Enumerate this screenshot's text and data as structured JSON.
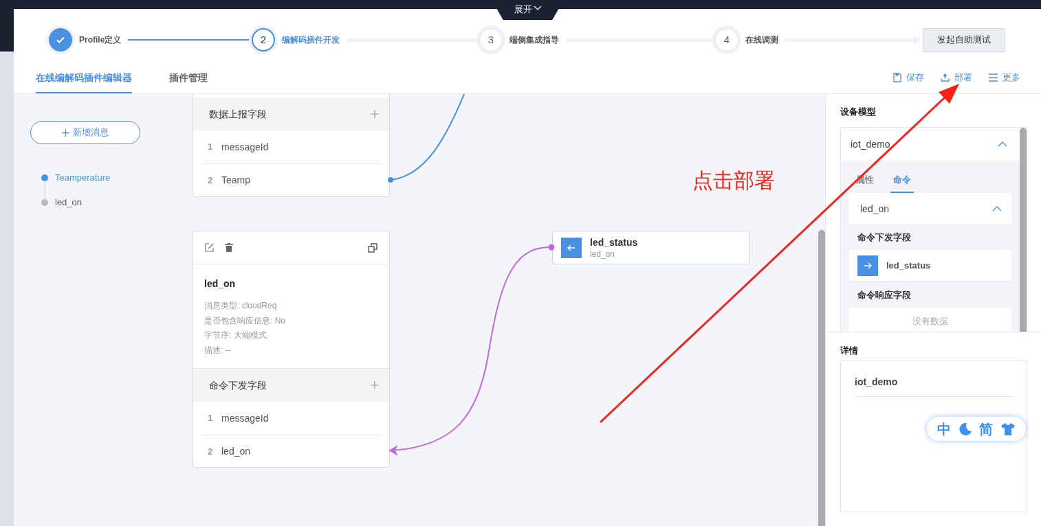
{
  "expand_tab": {
    "label": "展开"
  },
  "steps": [
    {
      "label": "Profile定义",
      "completed": true,
      "selected": false
    },
    {
      "number": "2",
      "label": "编解码插件开发",
      "completed": false,
      "selected": true
    },
    {
      "number": "3",
      "label": "端侧集成指导",
      "completed": false,
      "selected": false
    },
    {
      "number": "4",
      "label": "在线调测",
      "completed": false,
      "selected": false
    }
  ],
  "test_button": "发起自助测试",
  "tabs": [
    {
      "label": "在线编解码插件编辑器",
      "selected": true
    },
    {
      "label": "插件管理",
      "selected": false
    }
  ],
  "actions": [
    {
      "kind": "save",
      "label": "保存"
    },
    {
      "kind": "deploy",
      "label": "部署"
    },
    {
      "kind": "more",
      "label": "更多"
    }
  ],
  "sidebar": {
    "add_button": "新增消息",
    "messages": [
      {
        "label": "Teamperature",
        "selected": true
      },
      {
        "label": "led_on",
        "selected": false
      }
    ]
  },
  "canvas": {
    "report_card": {
      "section": "数据上报字段",
      "fields": [
        {
          "index": "1",
          "name": "messageId"
        },
        {
          "index": "2",
          "name": "Teamp"
        }
      ]
    },
    "command_card": {
      "title": "led_on",
      "details": [
        "消息类型: cloudReq",
        "是否包含响应信息: No",
        "字节序: 大端模式",
        "描述: --"
      ],
      "section": "命令下发字段",
      "fields": [
        {
          "index": "1",
          "name": "messageId"
        },
        {
          "index": "2",
          "name": "led_on"
        }
      ]
    },
    "node": {
      "name": "led_status",
      "subtitle": "led_on"
    }
  },
  "model_panel": {
    "title": "设备模型",
    "device": "iot_demo",
    "expanded": true,
    "tabs": [
      {
        "label": "属性",
        "selected": false
      },
      {
        "label": "命令",
        "selected": true
      }
    ],
    "command": {
      "name": "led_on",
      "expanded": true,
      "downlink_title": "命令下发字段",
      "downlink_items": [
        "led_status"
      ],
      "response_title": "命令响应字段",
      "response_empty": "没有数据"
    }
  },
  "details_panel": {
    "title": "详情",
    "name": "iot_demo"
  },
  "widget": {
    "items": [
      {
        "kind": "text",
        "label": "中"
      },
      {
        "kind": "moon"
      },
      {
        "kind": "text",
        "label": "简"
      },
      {
        "kind": "shirt"
      }
    ]
  },
  "annotation": {
    "text": "点击部署"
  }
}
